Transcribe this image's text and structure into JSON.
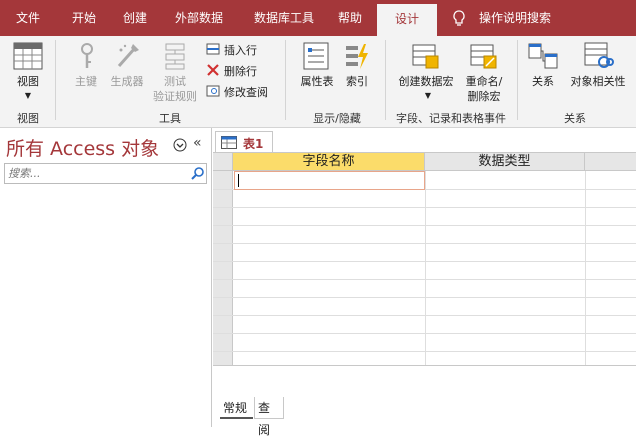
{
  "tabs": [
    "文件",
    "开始",
    "创建",
    "外部数据",
    "数据库工具",
    "帮助",
    "设计",
    "操作说明搜索"
  ],
  "active_tab": "设计",
  "ribbon": {
    "view": {
      "label": "视图",
      "group": "视图"
    },
    "tools": {
      "primary_key": "主键",
      "builder": "生成器",
      "test_line1": "测试",
      "test_line2": "验证规则",
      "insert_row": "插入行",
      "delete_row": "删除行",
      "modify_lookup": "修改查阅",
      "group": "工具"
    },
    "showhide": {
      "property_sheet": "属性表",
      "indexes": "索引",
      "group": "显示/隐藏"
    },
    "field_events": {
      "create_macro": "创建数据宏",
      "rename_line1": "重命名/",
      "rename_line2": "删除宏",
      "group": "字段、记录和表格事件"
    },
    "relationships": {
      "relations": "关系",
      "dependencies": "对象相关性",
      "group": "关系"
    }
  },
  "nav": {
    "title": "所有 Access 对象",
    "search_placeholder": "搜索..."
  },
  "document_tab": "表1",
  "grid": {
    "columns": [
      "字段名称",
      "数据类型"
    ]
  },
  "bottom_tabs": [
    "常规",
    "查阅"
  ],
  "colors": {
    "accent": "#a4373a",
    "ribbon_bg": "#f3f3f3"
  }
}
